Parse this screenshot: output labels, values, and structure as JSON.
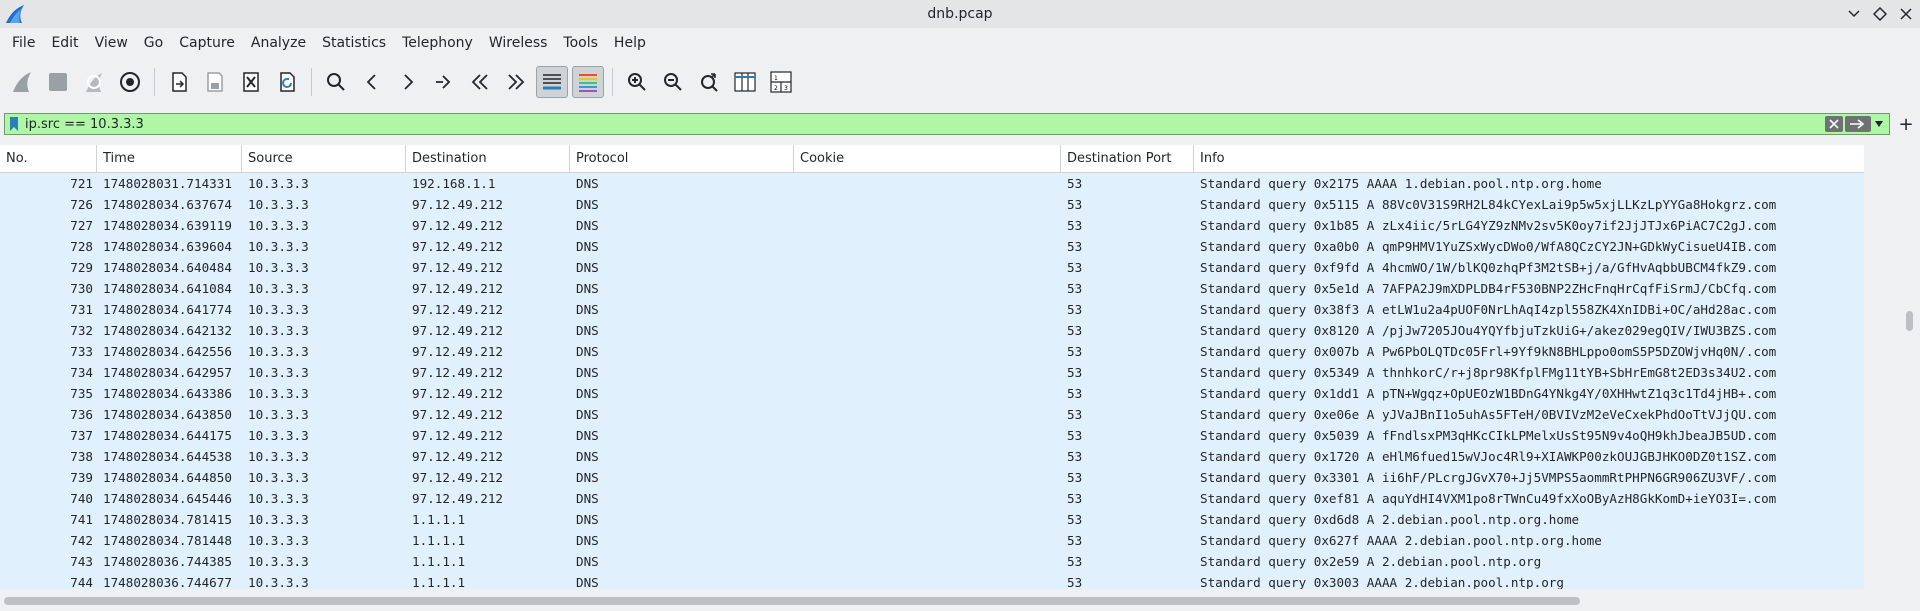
{
  "window": {
    "title": "dnb.pcap",
    "app_icon": "wireshark-fin-icon",
    "controls": [
      "chevron-down-icon",
      "diamond-icon",
      "close-icon"
    ]
  },
  "menu": [
    "File",
    "Edit",
    "View",
    "Go",
    "Capture",
    "Analyze",
    "Statistics",
    "Telephony",
    "Wireless",
    "Tools",
    "Help"
  ],
  "toolbar": {
    "groups": [
      [
        "start-capture-icon",
        "stop-capture-icon",
        "restart-capture-icon",
        "capture-options-icon"
      ],
      [
        "open-file-icon",
        "save-file-icon",
        "close-file-icon",
        "reload-file-icon"
      ],
      [
        "find-packet-icon",
        "go-back-icon",
        "go-forward-icon",
        "go-to-packet-icon",
        "first-packet-icon",
        "last-packet-icon",
        "autoscroll-icon",
        "colorize-icon"
      ],
      [
        "zoom-in-icon",
        "zoom-out-icon",
        "normal-size-icon",
        "resize-columns-icon",
        "layout-icon"
      ]
    ]
  },
  "filter": {
    "value": "ip.src == 10.3.3.3",
    "add_label": "+"
  },
  "columns": [
    "No.",
    "Time",
    "Source",
    "Destination",
    "Protocol",
    "Cookie",
    "Destination Port",
    "Info"
  ],
  "packets": [
    {
      "no": "721",
      "time": "1748028031.714331",
      "src": "10.3.3.3",
      "dst": "192.168.1.1",
      "proto": "DNS",
      "cookie": "",
      "dport": "53",
      "info": "Standard query 0x2175 AAAA 1.debian.pool.ntp.org.home"
    },
    {
      "no": "726",
      "time": "1748028034.637674",
      "src": "10.3.3.3",
      "dst": "97.12.49.212",
      "proto": "DNS",
      "cookie": "",
      "dport": "53",
      "info": "Standard query 0x5115 A 88Vc0V31S9RH2L84kCYexLai9p5w5xjLLKzLpYYGa8Hokgrz.com"
    },
    {
      "no": "727",
      "time": "1748028034.639119",
      "src": "10.3.3.3",
      "dst": "97.12.49.212",
      "proto": "DNS",
      "cookie": "",
      "dport": "53",
      "info": "Standard query 0x1b85 A zLx4iic/5rLG4YZ9zNMv2sv5K0oy7if2JjJTJx6PiAC7C2gJ.com"
    },
    {
      "no": "728",
      "time": "1748028034.639604",
      "src": "10.3.3.3",
      "dst": "97.12.49.212",
      "proto": "DNS",
      "cookie": "",
      "dport": "53",
      "info": "Standard query 0xa0b0 A qmP9HMV1YuZSxWycDWo0/WfA8QCzCY2JN+GDkWyCisueU4IB.com"
    },
    {
      "no": "729",
      "time": "1748028034.640484",
      "src": "10.3.3.3",
      "dst": "97.12.49.212",
      "proto": "DNS",
      "cookie": "",
      "dport": "53",
      "info": "Standard query 0xf9fd A 4hcmWO/1W/blKQ0zhqPf3M2tSB+j/a/GfHvAqbbUBCM4fkZ9.com"
    },
    {
      "no": "730",
      "time": "1748028034.641084",
      "src": "10.3.3.3",
      "dst": "97.12.49.212",
      "proto": "DNS",
      "cookie": "",
      "dport": "53",
      "info": "Standard query 0x5e1d A 7AFPA2J9mXDPLDB4rF530BNP2ZHcFnqHrCqfFiSrmJ/CbCfq.com"
    },
    {
      "no": "731",
      "time": "1748028034.641774",
      "src": "10.3.3.3",
      "dst": "97.12.49.212",
      "proto": "DNS",
      "cookie": "",
      "dport": "53",
      "info": "Standard query 0x38f3 A etLW1u2a4pUOF0NrLhAqI4zpl558ZK4XnIDBi+OC/aHd28ac.com"
    },
    {
      "no": "732",
      "time": "1748028034.642132",
      "src": "10.3.3.3",
      "dst": "97.12.49.212",
      "proto": "DNS",
      "cookie": "",
      "dport": "53",
      "info": "Standard query 0x8120 A /pjJw7205JOu4YQYfbjuTzkUiG+/akez029egQIV/IWU3BZS.com"
    },
    {
      "no": "733",
      "time": "1748028034.642556",
      "src": "10.3.3.3",
      "dst": "97.12.49.212",
      "proto": "DNS",
      "cookie": "",
      "dport": "53",
      "info": "Standard query 0x007b A Pw6PbOLQTDc05Frl+9Yf9kN8BHLppo0omS5P5DZOWjvHq0N/.com"
    },
    {
      "no": "734",
      "time": "1748028034.642957",
      "src": "10.3.3.3",
      "dst": "97.12.49.212",
      "proto": "DNS",
      "cookie": "",
      "dport": "53",
      "info": "Standard query 0x5349 A thnhkorC/r+j8pr98KfplFMg11tYB+SbHrEmG8t2ED3s34U2.com"
    },
    {
      "no": "735",
      "time": "1748028034.643386",
      "src": "10.3.3.3",
      "dst": "97.12.49.212",
      "proto": "DNS",
      "cookie": "",
      "dport": "53",
      "info": "Standard query 0x1dd1 A pTN+Wgqz+OpUEOzW1BDnG4YNkg4Y/0XHHwtZ1q3c1Td4jHB+.com"
    },
    {
      "no": "736",
      "time": "1748028034.643850",
      "src": "10.3.3.3",
      "dst": "97.12.49.212",
      "proto": "DNS",
      "cookie": "",
      "dport": "53",
      "info": "Standard query 0xe06e A yJVaJBnI1o5uhAs5FTeH/0BVIVzM2eVeCxekPhdOoTtVJjQU.com"
    },
    {
      "no": "737",
      "time": "1748028034.644175",
      "src": "10.3.3.3",
      "dst": "97.12.49.212",
      "proto": "DNS",
      "cookie": "",
      "dport": "53",
      "info": "Standard query 0x5039 A fFndlsxPM3qHKcCIkLPMelxUsSt95N9v4oQH9khJbeaJB5UD.com"
    },
    {
      "no": "738",
      "time": "1748028034.644538",
      "src": "10.3.3.3",
      "dst": "97.12.49.212",
      "proto": "DNS",
      "cookie": "",
      "dport": "53",
      "info": "Standard query 0x1720 A eHlM6fued15wVJoc4Rl9+XIAWKP00zkOUJGBJHKO0DZ0t1SZ.com"
    },
    {
      "no": "739",
      "time": "1748028034.644850",
      "src": "10.3.3.3",
      "dst": "97.12.49.212",
      "proto": "DNS",
      "cookie": "",
      "dport": "53",
      "info": "Standard query 0x3301 A ii6hF/PLcrgJGvX70+Jj5VMPS5aommRtPHPN6GR906ZU3VF/.com"
    },
    {
      "no": "740",
      "time": "1748028034.645446",
      "src": "10.3.3.3",
      "dst": "97.12.49.212",
      "proto": "DNS",
      "cookie": "",
      "dport": "53",
      "info": "Standard query 0xef81 A aquYdHI4VXM1po8rTWnCu49fxXoOByAzH8GkKomD+ieYO3I=.com"
    },
    {
      "no": "741",
      "time": "1748028034.781415",
      "src": "10.3.3.3",
      "dst": "1.1.1.1",
      "proto": "DNS",
      "cookie": "",
      "dport": "53",
      "info": "Standard query 0xd6d8 A 2.debian.pool.ntp.org.home"
    },
    {
      "no": "742",
      "time": "1748028034.781448",
      "src": "10.3.3.3",
      "dst": "1.1.1.1",
      "proto": "DNS",
      "cookie": "",
      "dport": "53",
      "info": "Standard query 0x627f AAAA 2.debian.pool.ntp.org.home"
    },
    {
      "no": "743",
      "time": "1748028036.744385",
      "src": "10.3.3.3",
      "dst": "1.1.1.1",
      "proto": "DNS",
      "cookie": "",
      "dport": "53",
      "info": "Standard query 0x2e59 A 2.debian.pool.ntp.org"
    },
    {
      "no": "744",
      "time": "1748028036.744677",
      "src": "10.3.3.3",
      "dst": "1.1.1.1",
      "proto": "DNS",
      "cookie": "",
      "dport": "53",
      "info": "Standard query 0x3003 AAAA 2.debian.pool.ntp.org"
    }
  ],
  "colors": {
    "row_bg": "#e1f0fd",
    "filter_bg": "#aff7a6",
    "accent": "#2980b9"
  }
}
